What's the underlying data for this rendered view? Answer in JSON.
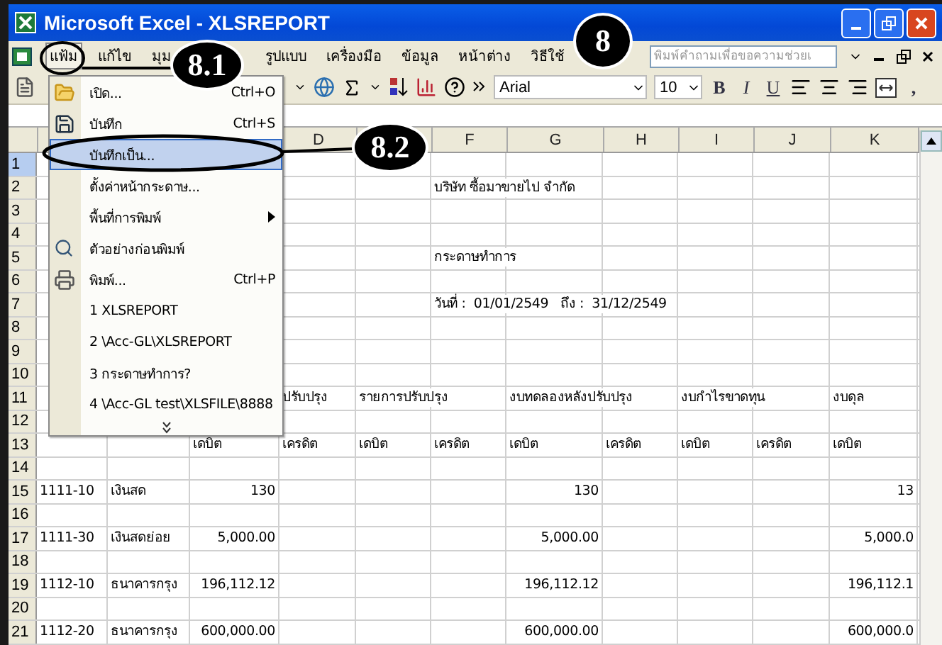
{
  "window": {
    "title": "Microsoft Excel - XLSREPORT"
  },
  "menu_bar": {
    "items": [
      {
        "label": "แฟ้ม",
        "selected": true
      },
      {
        "label": "แก้ไข",
        "selected": false
      },
      {
        "label": "มุม",
        "selected": false
      },
      {
        "label": "รูปแบบ",
        "selected": false
      },
      {
        "label": "เครื่องมือ",
        "selected": false
      },
      {
        "label": "ข้อมูล",
        "selected": false
      },
      {
        "label": "หน้าต่าง",
        "selected": false
      },
      {
        "label": "วิธีใช้",
        "selected": false
      }
    ],
    "help_box": {
      "placeholder": "พิมพ์คำถามเพื่อขอความช่วยเ"
    }
  },
  "toolbar": {
    "font": "Arial",
    "size": "10",
    "format_buttons": [
      "B",
      "I",
      "U"
    ],
    "comma": ","
  },
  "file_menu": {
    "items": [
      {
        "label": "เปิด...",
        "shortcut": "Ctrl+O",
        "selected": false
      },
      {
        "label": "บันทึก",
        "shortcut": "Ctrl+S",
        "selected": false
      },
      {
        "label": "บันทึกเป็น...",
        "selected": true
      },
      {
        "label": "ตั้งค่าหน้ากระดาษ...",
        "selected": false
      },
      {
        "label": "พื้นที่การพิมพ์",
        "selected": false,
        "submenu": true
      },
      {
        "label": "ตัวอย่างก่อนพิมพ์",
        "selected": false
      },
      {
        "label": "พิมพ์...",
        "shortcut": "Ctrl+P",
        "selected": false
      },
      {
        "label": "1 XLSREPORT",
        "selected": false
      },
      {
        "label": "2 \\Acc-GL\\XLSREPORT",
        "selected": false
      },
      {
        "label": "3 กระดาษทำการ?",
        "selected": false
      },
      {
        "label": "4 \\Acc-GL test\\XLSFILE\\8888",
        "selected": false
      }
    ]
  },
  "sheet": {
    "column_headers": {
      "D": "D",
      "F": "F",
      "G": "G",
      "H": "H",
      "I": "I",
      "J": "J",
      "K": "K"
    },
    "rows": [
      {
        "number": "1",
        "selected": true
      },
      {
        "number": "2",
        "selected": false,
        "cells": {
          "F": {
            "text": "บริษัท ซื้อมาขายไป จำกัด",
            "kind": "text"
          }
        }
      },
      {
        "number": "3",
        "selected": false
      },
      {
        "number": "4",
        "selected": false
      },
      {
        "number": "5",
        "selected": false,
        "cells": {
          "F": {
            "text": "กระดาษทำการ",
            "kind": "text"
          }
        }
      },
      {
        "number": "6",
        "selected": false
      },
      {
        "number": "7",
        "selected": false,
        "cells": {
          "F": {
            "text": "วันที่ :  01/01/2549   ถึง :  31/12/2549",
            "kind": "text"
          }
        }
      },
      {
        "number": "8",
        "selected": false
      },
      {
        "number": "9",
        "selected": false
      },
      {
        "number": "10",
        "selected": false
      },
      {
        "number": "11",
        "selected": false,
        "cells": {
          "D": {
            "text": "ปรับปรุง",
            "kind": "text"
          },
          "E": {
            "text": "รายการปรับปรุง",
            "kind": "text"
          },
          "G": {
            "text": "งบทดลองหลังปรับปรุง",
            "kind": "text"
          },
          "I": {
            "text": "งบกำไรขาดทุน",
            "kind": "text"
          },
          "K": {
            "text": "งบดุล",
            "kind": "text"
          }
        }
      },
      {
        "number": "12",
        "selected": false
      },
      {
        "number": "13",
        "selected": false,
        "cells": {
          "C": {
            "text": "เดบิต",
            "kind": "text"
          },
          "D": {
            "text": "เครดิต",
            "kind": "text"
          },
          "E": {
            "text": "เดบิต",
            "kind": "text"
          },
          "F": {
            "text": "เครดิต",
            "kind": "text"
          },
          "G": {
            "text": "เดบิต",
            "kind": "text"
          },
          "H": {
            "text": "เครดิต",
            "kind": "text"
          },
          "I": {
            "text": "เดบิต",
            "kind": "text"
          },
          "J": {
            "text": "เครดิต",
            "kind": "text"
          },
          "K": {
            "text": "เดบิต",
            "kind": "text"
          }
        }
      },
      {
        "number": "14",
        "selected": false
      },
      {
        "number": "15",
        "selected": false,
        "cells": {
          "A": {
            "text": "1111-10",
            "kind": "text"
          },
          "B": {
            "text": "เงินสด",
            "kind": "text"
          },
          "C": {
            "text": "130",
            "kind": "number"
          },
          "G": {
            "text": "130",
            "kind": "number"
          },
          "K": {
            "text": "13",
            "kind": "number"
          }
        }
      },
      {
        "number": "16",
        "selected": false
      },
      {
        "number": "17",
        "selected": false,
        "cells": {
          "A": {
            "text": "1111-30",
            "kind": "text"
          },
          "B": {
            "text": "เงินสดย่อย",
            "kind": "text"
          },
          "C": {
            "text": "5,000.00",
            "kind": "number"
          },
          "G": {
            "text": "5,000.00",
            "kind": "number"
          },
          "K": {
            "text": "5,000.0",
            "kind": "number"
          }
        }
      },
      {
        "number": "18",
        "selected": false
      },
      {
        "number": "19",
        "selected": false,
        "cells": {
          "A": {
            "text": "1112-10",
            "kind": "text"
          },
          "B": {
            "text": "ธนาคารกรุง",
            "kind": "text"
          },
          "C": {
            "text": "196,112.12",
            "kind": "number"
          },
          "G": {
            "text": "196,112.12",
            "kind": "number"
          },
          "K": {
            "text": "196,112.1",
            "kind": "number"
          }
        }
      },
      {
        "number": "20",
        "selected": false
      },
      {
        "number": "21",
        "selected": false,
        "cells": {
          "A": {
            "text": "1112-20",
            "kind": "text"
          },
          "B": {
            "text": "ธนาคารกรุง",
            "kind": "text"
          },
          "C": {
            "text": "600,000.00",
            "kind": "number"
          },
          "G": {
            "text": "600,000.00",
            "kind": "number"
          },
          "K": {
            "text": "600,000.0",
            "kind": "number"
          }
        }
      }
    ]
  },
  "annotations": [
    {
      "label": "8"
    },
    {
      "label": "8.1"
    },
    {
      "label": "8.2"
    }
  ]
}
